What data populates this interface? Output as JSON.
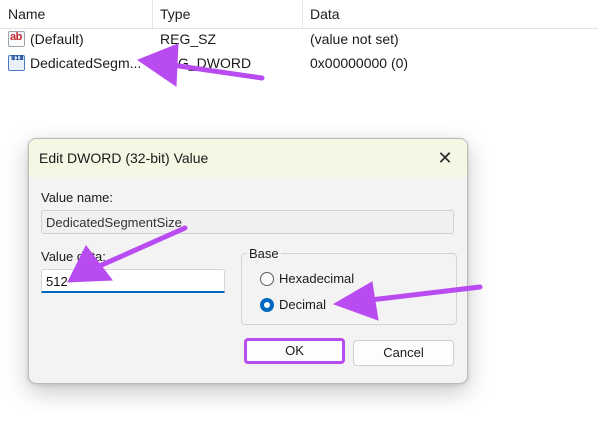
{
  "list": {
    "columns": {
      "name": "Name",
      "type": "Type",
      "data": "Data"
    },
    "rows": [
      {
        "name": "(Default)",
        "type": "REG_SZ",
        "data": "(value not set)",
        "icon": "string-value-icon"
      },
      {
        "name": "DedicatedSegm...",
        "type": "G_DWORD",
        "data": "0x00000000 (0)",
        "icon": "dword-value-icon"
      }
    ],
    "icon_text": {
      "sz": "ab",
      "dw_top": "011",
      "dw_bottom": "110"
    }
  },
  "dialog": {
    "title": "Edit DWORD (32-bit) Value",
    "close_glyph": "✕",
    "value_name_label": "Value name:",
    "value_name": "DedicatedSegmentSize",
    "value_data_label": "Value data:",
    "value_data": "512",
    "base_label": "Base",
    "options": [
      {
        "label": "Hexadecimal",
        "selected": false
      },
      {
        "label": "Decimal",
        "selected": true
      }
    ],
    "ok_label": "OK",
    "cancel_label": "Cancel"
  },
  "annotations": {
    "arrow_color": "#b94cf0"
  }
}
